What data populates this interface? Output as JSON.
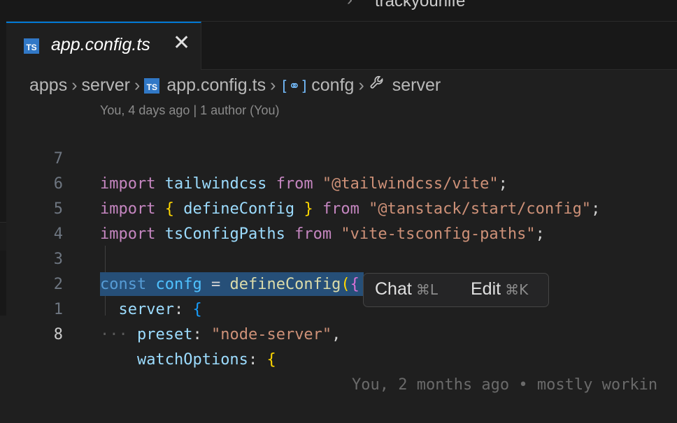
{
  "window": {
    "title": "trackyourlife",
    "title_separator": "›"
  },
  "tab": {
    "icon_text": "TS",
    "label": "app.config.ts",
    "close_glyph": "✕"
  },
  "breadcrumb": {
    "items": [
      "apps",
      "server",
      "app.config.ts",
      "confg",
      "server"
    ],
    "separator": "›",
    "file_icon_text": "TS",
    "symbol_icon_glyph": "[⚭]"
  },
  "blame": {
    "header": "You, 4 days ago | 1 author (You)",
    "inline": "You, 2 months ago • mostly workin"
  },
  "editor": {
    "line_numbers": [
      "7",
      "6",
      "5",
      "4",
      "3",
      "2",
      "1",
      "8"
    ],
    "lines": {
      "l7": {
        "k1": "import",
        "id": "tailwindcss",
        "k2": "from",
        "s": "\"@tailwindcss/vite\"",
        "end": ";"
      },
      "l6": {
        "k1": "import",
        "b1": "{",
        "id": "defineConfig",
        "b2": "}",
        "k2": "from",
        "s": "\"@tanstack/start/config\"",
        "end": ";"
      },
      "l5": {
        "k1": "import",
        "id": "tsConfigPaths",
        "k2": "from",
        "s": "\"vite-tsconfig-paths\"",
        "end": ";"
      },
      "l3": {
        "kw": "const",
        "id": "confg",
        "eq": "=",
        "fn": "defineConfig",
        "p": "(",
        "b": "{"
      },
      "l2": {
        "prop": "server",
        "colon": ":",
        "b": "{"
      },
      "l1": {
        "dots": "···",
        "prop": "preset",
        "colon": ":",
        "s": "\"node-server\"",
        "comma": ","
      },
      "l8": {
        "prop": "watchOptions",
        "colon": ":",
        "b": "{"
      }
    }
  },
  "chat_popup": {
    "chat_label": "Chat",
    "chat_shortcut": "⌘L",
    "edit_label": "Edit",
    "edit_shortcut": "⌘K"
  },
  "colors": {
    "accent": "#0078d4",
    "ts_icon": "#3178c6",
    "selection": "#264f78"
  }
}
